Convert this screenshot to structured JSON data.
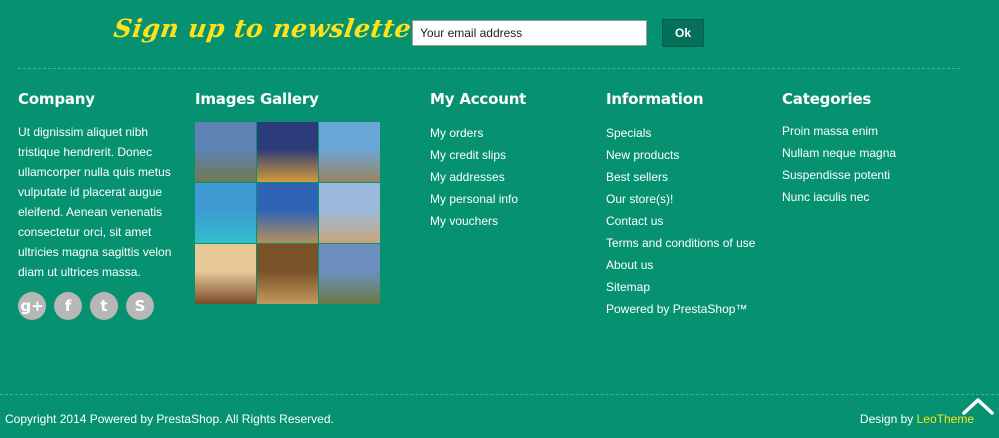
{
  "newsletter": {
    "title": "Sign up to newsletter",
    "input_value": "Your email address",
    "ok_label": "Ok"
  },
  "company": {
    "heading": "Company",
    "text": "Ut dignissim aliquet nibh tristique hendrerit. Donec ullamcorper nulla quis metus vulputate id placerat augue eleifend. Aenean venenatis consectetur orci, sit amet ultricies magna sagittis velon diam ut ultrices massa.",
    "social_icons": [
      {
        "name": "google-plus-icon",
        "glyph": "g+"
      },
      {
        "name": "facebook-icon",
        "glyph": "f"
      },
      {
        "name": "tumblr-icon",
        "glyph": "t"
      },
      {
        "name": "skype-icon",
        "glyph": "S"
      }
    ]
  },
  "gallery": {
    "heading": "Images Gallery",
    "tiles": [
      {
        "name": "stonehenge",
        "c1": "#5d82b3",
        "c2": "#6f7a4f"
      },
      {
        "name": "temple-night",
        "c1": "#2c3b7a",
        "c2": "#d49b3a"
      },
      {
        "name": "island-rocks",
        "c1": "#6ba6d8",
        "c2": "#9a8460"
      },
      {
        "name": "resort-pool",
        "c1": "#3f9ad1",
        "c2": "#2fbfc9"
      },
      {
        "name": "sphinx",
        "c1": "#2f63b5",
        "c2": "#b8905a"
      },
      {
        "name": "palace-courtyard",
        "c1": "#9cbadb",
        "c2": "#c9a57a"
      },
      {
        "name": "hotel-lobby",
        "c1": "#e6c997",
        "c2": "#7d4b2b"
      },
      {
        "name": "hotel-room",
        "c1": "#7a5228",
        "c2": "#c29a5e"
      },
      {
        "name": "stonehenge-2",
        "c1": "#6c8fbf",
        "c2": "#6a7a45"
      }
    ]
  },
  "account": {
    "heading": "My Account",
    "links": [
      "My orders",
      "My credit slips",
      "My addresses",
      "My personal info",
      "My vouchers"
    ]
  },
  "information": {
    "heading": "Information",
    "links": [
      "Specials",
      "New products",
      "Best sellers",
      "Our store(s)!",
      "Contact us",
      "Terms and conditions of use",
      "About us",
      "Sitemap",
      "Powered by PrestaShop™"
    ]
  },
  "categories": {
    "heading": "Categories",
    "links": [
      "Proin massa enim",
      "Nullam neque magna",
      "Suspendisse potenti",
      "Nunc iaculis nec"
    ]
  },
  "footer": {
    "copyright": "Copyright 2014 Powered by PrestaShop. All Rights Reserved.",
    "design_prefix": "Design by ",
    "design_link": "LeoTheme"
  },
  "colors": {
    "background": "#069270",
    "accent": "#ffe11b"
  }
}
